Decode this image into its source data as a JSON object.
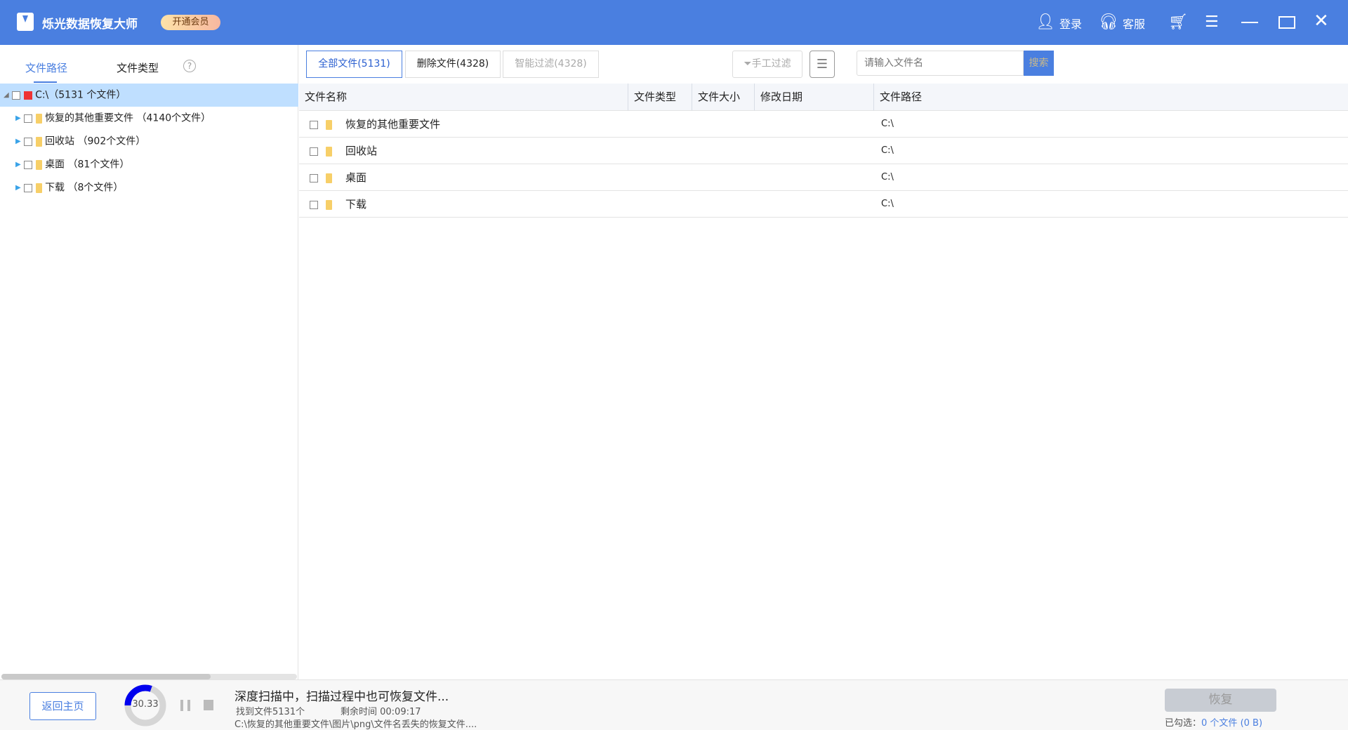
{
  "header": {
    "title": "烁光数据恢复大师",
    "vip": "开通会员",
    "login": "登录",
    "service": "客服"
  },
  "left": {
    "tabs": [
      "文件路径",
      "文件类型"
    ],
    "help": "?",
    "tree": [
      {
        "label": "C:\\（5131 个文件）"
      },
      {
        "label": "恢复的其他重要文件 （4140个文件）"
      },
      {
        "label": "回收站 （902个文件）"
      },
      {
        "label": "桌面 （81个文件）"
      },
      {
        "label": "下载 （8个文件）"
      }
    ]
  },
  "toolbar": {
    "all": "全部文件(5131)",
    "deleted": "删除文件(4328)",
    "smart": "智能过滤(4328)",
    "manual": "手工过滤",
    "search_placeholder": "请输入文件名",
    "search": "搜索"
  },
  "table": {
    "columns": [
      "文件名称",
      "文件类型",
      "文件大小",
      "修改日期",
      "文件路径"
    ],
    "rows": [
      {
        "name": "恢复的其他重要文件",
        "path": "C:\\"
      },
      {
        "name": "回收站",
        "path": "C:\\"
      },
      {
        "name": "桌面",
        "path": "C:\\"
      },
      {
        "name": "下载",
        "path": "C:\\"
      }
    ]
  },
  "footer": {
    "back": "返回主页",
    "progress": "30.33",
    "progress_percent": 30.33,
    "status": "深度扫描中，扫描过程中也可恢复文件...",
    "found": "找到文件5131个",
    "remaining": "剩余时间 00:09:17",
    "current": "C:\\恢复的其他重要文件\\图片\\png\\文件名丢失的恢复文件....",
    "recover": "恢复",
    "selected_label": "已勾选：",
    "selected_count": "0 个文件",
    "selected_size": "(0 B)"
  }
}
